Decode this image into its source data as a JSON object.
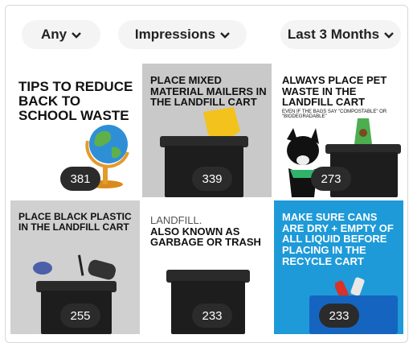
{
  "filters": {
    "type": {
      "label": "Any"
    },
    "metric": {
      "label": "Impressions"
    },
    "range": {
      "label": "Last 3 Months"
    }
  },
  "tiles": [
    {
      "title": "TIPS TO REDUCE BACK TO SCHOOL WASTE",
      "count": "381"
    },
    {
      "title": "PLACE MIXED MATERIAL MAILERS IN THE LANDFILL CART",
      "count": "339"
    },
    {
      "title": "ALWAYS PLACE PET WASTE IN THE LANDFILL CART",
      "sub": "EVEN IF THE BAGS SAY \"COMPOSTABLE\" OR \"BIODEGRADABLE\"",
      "count": "273"
    },
    {
      "title": "PLACE BLACK PLASTIC IN THE LANDFILL CART",
      "count": "255"
    },
    {
      "pre": "LANDFILL.",
      "title": "ALSO KNOWN AS GARBAGE OR TRASH",
      "count": "233"
    },
    {
      "title": "MAKE SURE CANS ARE DRY + EMPTY OF ALL LIQUID BEFORE PLACING IN THE RECYCLE CART",
      "count": "233"
    }
  ],
  "colors": {
    "tile_gray": "#c9c9c9",
    "tile_blue": "#1e9ad8",
    "badge_bg": "#2b2b2b",
    "cart_black": "#1d1d1d",
    "recycle_blue": "#1565c0"
  },
  "icons": [
    "chevron-down-icon",
    "globe-icon",
    "mailer-bag-icon",
    "dog-icon",
    "landfill-cart-icon",
    "recycle-cart-icon"
  ]
}
